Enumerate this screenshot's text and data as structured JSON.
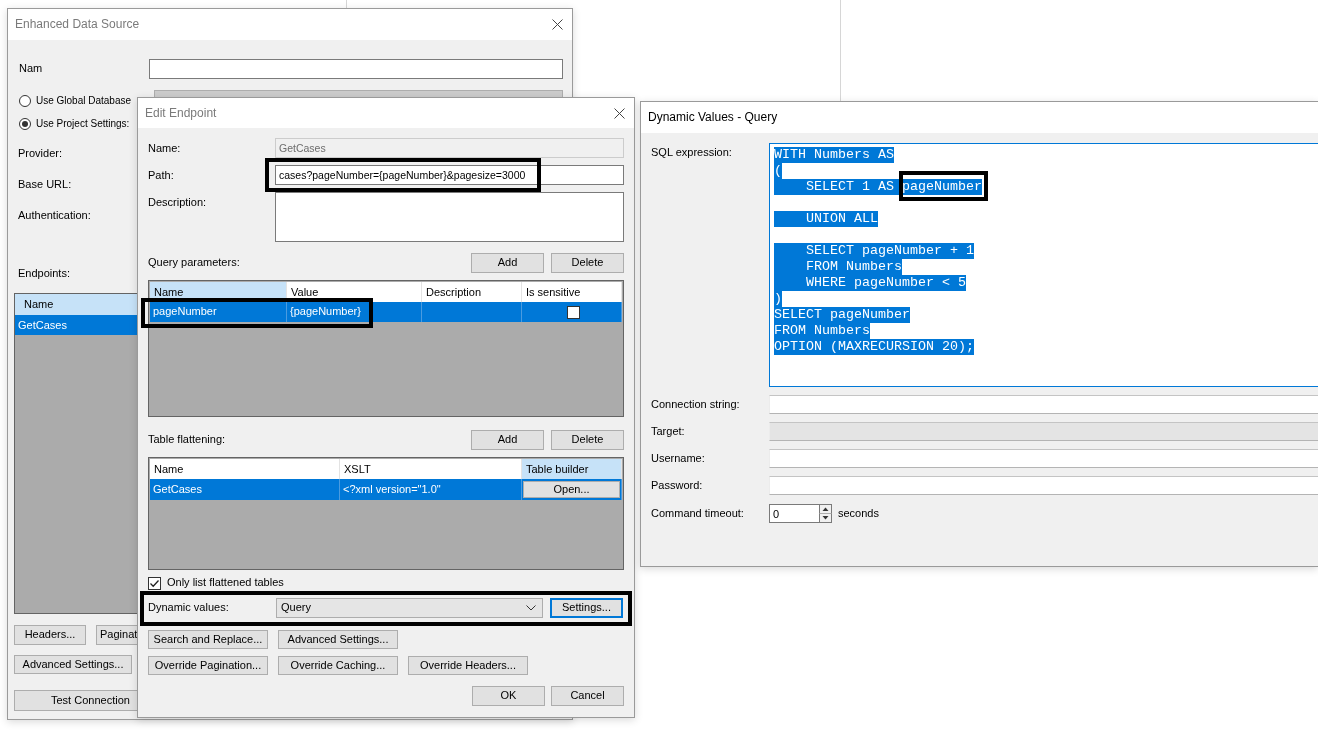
{
  "data_source_window": {
    "title": "Enhanced Data Source",
    "active": false,
    "name_label": "Nam",
    "source_options": [
      {
        "label": "Use Global Database",
        "selected": false
      },
      {
        "label": "Use Project Settings:",
        "selected": true
      }
    ],
    "field_labels": [
      "Provider:",
      "Base URL:",
      "Authentication:"
    ],
    "endpoints": {
      "label": "Endpoints:",
      "column": "Name",
      "items": [
        {
          "name": "GetCases",
          "selected": true
        }
      ]
    },
    "button_rows": [
      [
        "Headers...",
        "Paginat"
      ],
      [
        "Advanced Settings..."
      ],
      [
        "Test Connection"
      ]
    ]
  },
  "edit_endpoint_window": {
    "title": "Edit Endpoint",
    "active": false,
    "fields": [
      {
        "kind": "text",
        "label": "Name:",
        "value": "GetCases",
        "disabled": true,
        "outlined": false
      },
      {
        "kind": "text",
        "label": "Path:",
        "value": "cases?pageNumber={pageNumber}&pagesize=3000",
        "disabled": false,
        "outlined": true
      },
      {
        "kind": "textarea",
        "label": "Description:",
        "disabled": false,
        "outlined": false
      }
    ],
    "query_parameters": {
      "label": "Query parameters:",
      "buttons": [
        "Add",
        "Delete"
      ],
      "columns": [
        {
          "label": "Name",
          "highlighted": true
        },
        {
          "label": "Value",
          "highlighted": false
        },
        {
          "label": "Description",
          "highlighted": false
        },
        {
          "label": "Is sensitive",
          "highlighted": false
        }
      ],
      "rows": [
        {
          "name": "pageNumber",
          "value": "{pageNumber}",
          "is_sensitive": false,
          "selected": true,
          "outlined": true
        }
      ]
    },
    "table_flattening": {
      "label": "Table flattening:",
      "buttons": [
        "Add",
        "Delete"
      ],
      "columns": [
        {
          "label": "Name",
          "highlighted": false
        },
        {
          "label": "XSLT",
          "highlighted": false
        },
        {
          "label": "Table builder",
          "highlighted": true
        }
      ],
      "rows": [
        {
          "name": "GetCases",
          "xslt": "<?xml version=\"1.0\"",
          "action": "Open...",
          "selected": true
        }
      ]
    },
    "only_list_flattened": {
      "label": "Only list flattened tables",
      "checked": true
    },
    "dynamic_values": {
      "label": "Dynamic values:",
      "value": "Query",
      "button": {
        "label": "Settings...",
        "focused": true
      },
      "outlined": true
    },
    "action_button_rows": [
      [
        "Search and Replace...",
        "Advanced Settings..."
      ],
      [
        "Override Pagination...",
        "Override Caching...",
        "Override Headers..."
      ]
    ],
    "dialog_buttons": [
      "OK",
      "Cancel"
    ]
  },
  "dynamic_values_window": {
    "title": "Dynamic Values - Query",
    "active": true,
    "sql_expression": {
      "label": "SQL expression:",
      "focused": true,
      "text_selected": true,
      "blocks": [
        [
          {
            "text": "WITH Numbers AS"
          },
          {
            "text": "("
          },
          {
            "text": "    SELECT 1 AS ",
            "outlined_text": "pageNumber"
          }
        ],
        [
          {
            "text": "    UNION ALL"
          }
        ],
        [
          {
            "text": "    SELECT pageNumber + 1"
          },
          {
            "text": "    FROM Numbers"
          },
          {
            "text": "    WHERE pageNumber < 5"
          },
          {
            "text": ")"
          },
          {
            "text": "SELECT pageNumber"
          },
          {
            "text": "FROM Numbers"
          },
          {
            "text": "OPTION (MAXRECURSION 20);"
          }
        ]
      ]
    },
    "fields": [
      {
        "label": "Connection string:",
        "kind": "text"
      },
      {
        "label": "Target:",
        "kind": "dropdown"
      },
      {
        "label": "Username:",
        "kind": "text"
      },
      {
        "label": "Password:",
        "kind": "text"
      }
    ],
    "command_timeout": {
      "label": "Command timeout:",
      "value": "0",
      "unit": "seconds"
    }
  }
}
